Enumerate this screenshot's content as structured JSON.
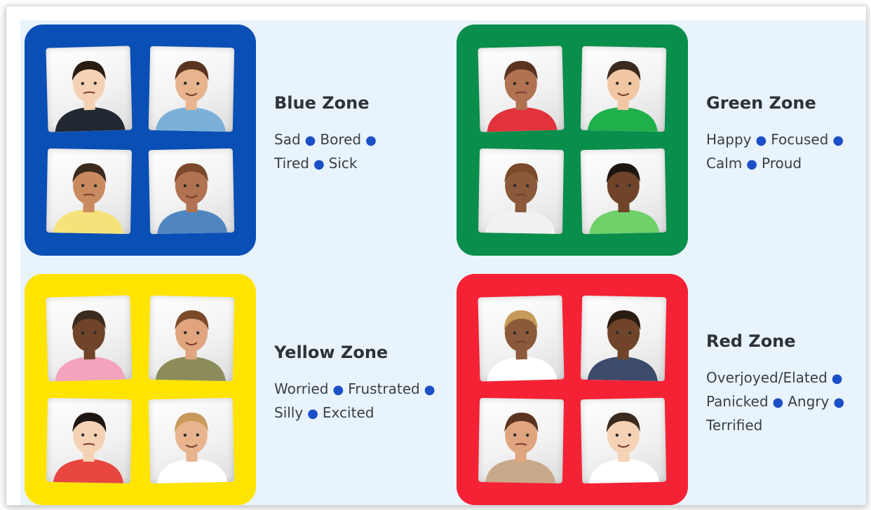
{
  "zones": [
    {
      "key": "blue",
      "title": "Blue Zone",
      "color": "#0a4fb5",
      "lines": [
        [
          "Sad",
          "Bored"
        ],
        [
          "Tired",
          "Sick"
        ]
      ]
    },
    {
      "key": "green",
      "title": "Green Zone",
      "color": "#0a8e4b",
      "lines": [
        [
          "Happy",
          "Focused"
        ],
        [
          "Calm",
          "Proud"
        ]
      ]
    },
    {
      "key": "yellow",
      "title": "Yellow Zone",
      "color": "#ffe400",
      "lines": [
        [
          "Worried",
          "Frustrated"
        ],
        [
          "Silly",
          "Excited"
        ]
      ]
    },
    {
      "key": "red",
      "title": "Red Zone",
      "color": "#f52235",
      "lines": [
        [
          "Overjoyed/Elated"
        ],
        [
          "Panicked",
          "Angry"
        ],
        [
          "Terrified"
        ]
      ]
    }
  ],
  "bullet_color": "#1c4fc7",
  "icons": [
    "child-photo-icon"
  ]
}
